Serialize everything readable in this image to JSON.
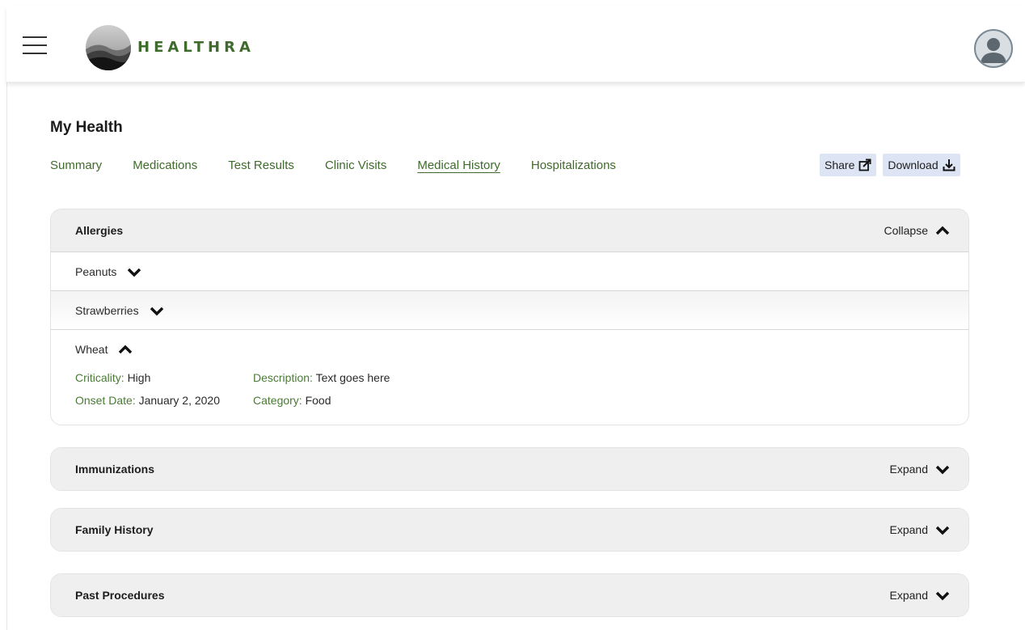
{
  "app": {
    "brand": "HEALTHRA"
  },
  "icons": {
    "menu": "hamburger-icon",
    "avatar": "user-avatar-icon",
    "share": "share-icon",
    "download": "download-icon"
  },
  "colors": {
    "accent": "#3f6b2c",
    "button_bg": "#dde4f4",
    "section_header_bg": "#efefef"
  },
  "page": {
    "title": "My Health",
    "tabs": [
      {
        "label": "Summary",
        "active": false
      },
      {
        "label": "Medications",
        "active": false
      },
      {
        "label": "Test Results",
        "active": false
      },
      {
        "label": "Clinic Visits",
        "active": false
      },
      {
        "label": "Medical History",
        "active": true
      },
      {
        "label": "Hospitalizations",
        "active": false
      }
    ],
    "actions": {
      "share": "Share",
      "download": "Download"
    }
  },
  "sections": [
    {
      "title": "Allergies",
      "toggle": "Collapse",
      "expanded": true,
      "items": [
        {
          "name": "Peanuts",
          "expanded": false
        },
        {
          "name": "Strawberries",
          "expanded": false
        },
        {
          "name": "Wheat",
          "expanded": true,
          "details": {
            "criticality_label": "Criticality:",
            "criticality": "High",
            "description_label": "Description:",
            "description": "Text goes here",
            "onset_label": "Onset Date:",
            "onset": "January 2, 2020",
            "category_label": "Category:",
            "category": "Food"
          }
        }
      ]
    },
    {
      "title": "Immunizations",
      "toggle": "Expand",
      "expanded": false
    },
    {
      "title": "Family History",
      "toggle": "Expand",
      "expanded": false
    },
    {
      "title": "Past Procedures",
      "toggle": "Expand",
      "expanded": false
    }
  ]
}
